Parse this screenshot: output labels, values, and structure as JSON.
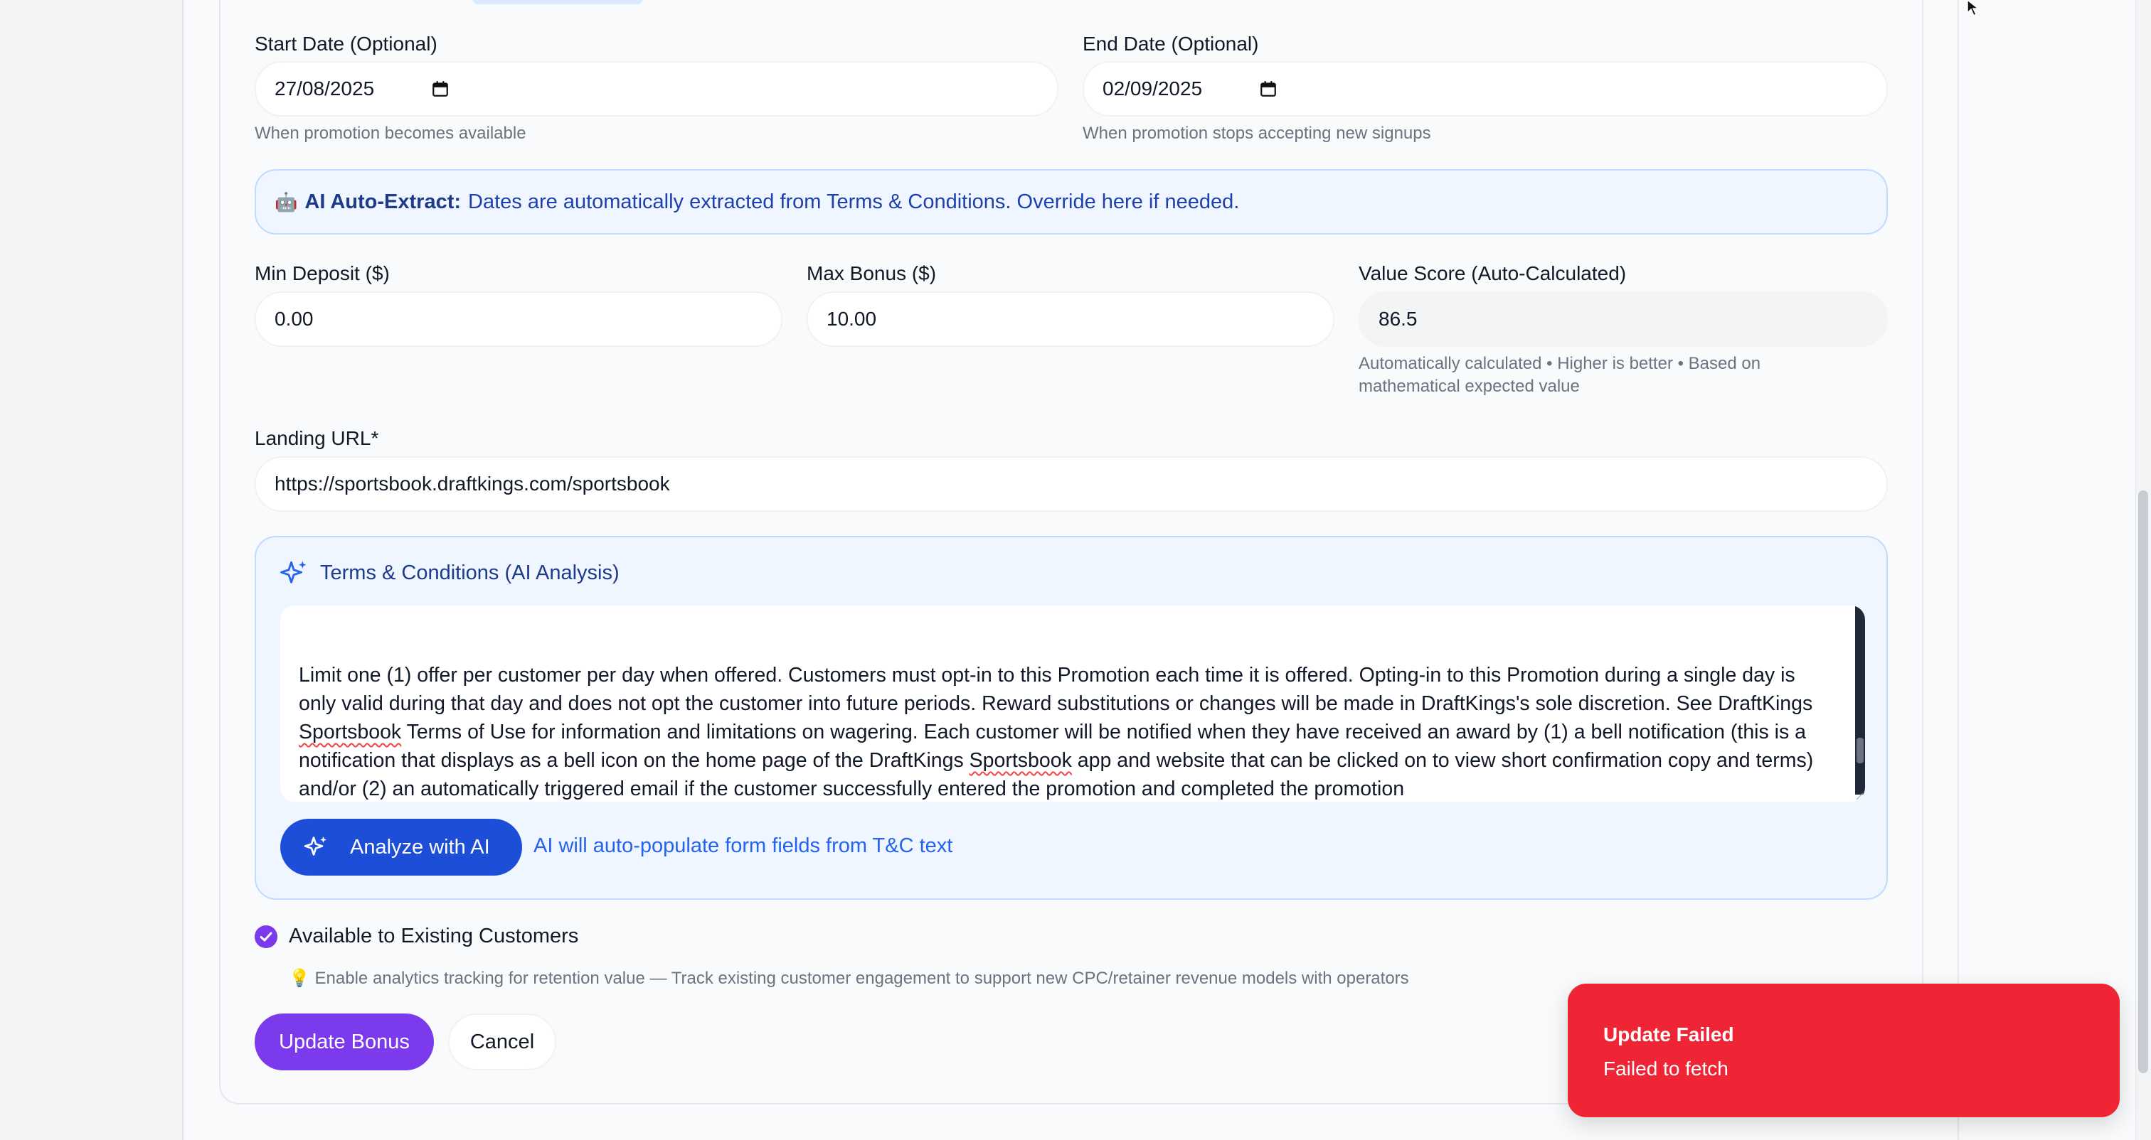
{
  "form": {
    "start_date": {
      "label": "Start Date (Optional)",
      "value": "27/08/2025",
      "help": "When promotion becomes available"
    },
    "end_date": {
      "label": "End Date (Optional)",
      "value": "02/09/2025",
      "help": "When promotion stops accepting new signups"
    },
    "ai_banner": {
      "icon": "robot-icon",
      "title": "AI Auto-Extract:",
      "text": "Dates are automatically extracted from Terms & Conditions. Override here if needed."
    },
    "min_deposit": {
      "label": "Min Deposit ($)",
      "value": "0.00"
    },
    "max_bonus": {
      "label": "Max Bonus ($)",
      "value": "10.00"
    },
    "value_score": {
      "label": "Value Score (Auto-Calculated)",
      "value": "86.5",
      "help": "Automatically calculated • Higher is better • Based on mathematical expected value"
    },
    "landing_url": {
      "label": "Landing URL*",
      "value": "https://sportsbook.draftkings.com/sportsbook"
    },
    "terms": {
      "title": "Terms & Conditions (AI Analysis)",
      "text_parts": [
        "Limit one (1) offer per customer per day when offered. Customers must opt-in to this Promotion each time it is offered. Opting-in to this Promotion during a single day is only valid during that day and does not opt the customer into future periods. Reward substitutions or changes will be made in DraftKings's sole discretion. See DraftKings ",
        "Sportsbook",
        " Terms of Use for information and limitations on wagering. Each customer will be notified when they have received an award by (1) a bell notification (this is a notification that displays as a bell icon on the home page of the DraftKings ",
        "Sportsbook",
        " app and website that can be clicked on to view short confirmation copy and terms) and/or (2) an automatically triggered email if the customer successfully entered the promotion and completed the promotion"
      ],
      "analyze_button": "Analyze with AI",
      "analyze_note": "AI will auto-populate form fields from T&C text"
    },
    "existing_customers": {
      "label": "Available to Existing Customers",
      "checked": true,
      "tip": "💡 Enable analytics tracking for retention value — Track existing customer engagement to support new CPC/retainer revenue models with operators"
    },
    "buttons": {
      "update": "Update Bonus",
      "cancel": "Cancel"
    }
  },
  "toast": {
    "title": "Update Failed",
    "message": "Failed to fetch",
    "color": "#ef2535"
  },
  "colors": {
    "accent_purple": "#7c3aed",
    "accent_blue": "#1d4ed8",
    "banner_bg": "#eff6ff"
  }
}
